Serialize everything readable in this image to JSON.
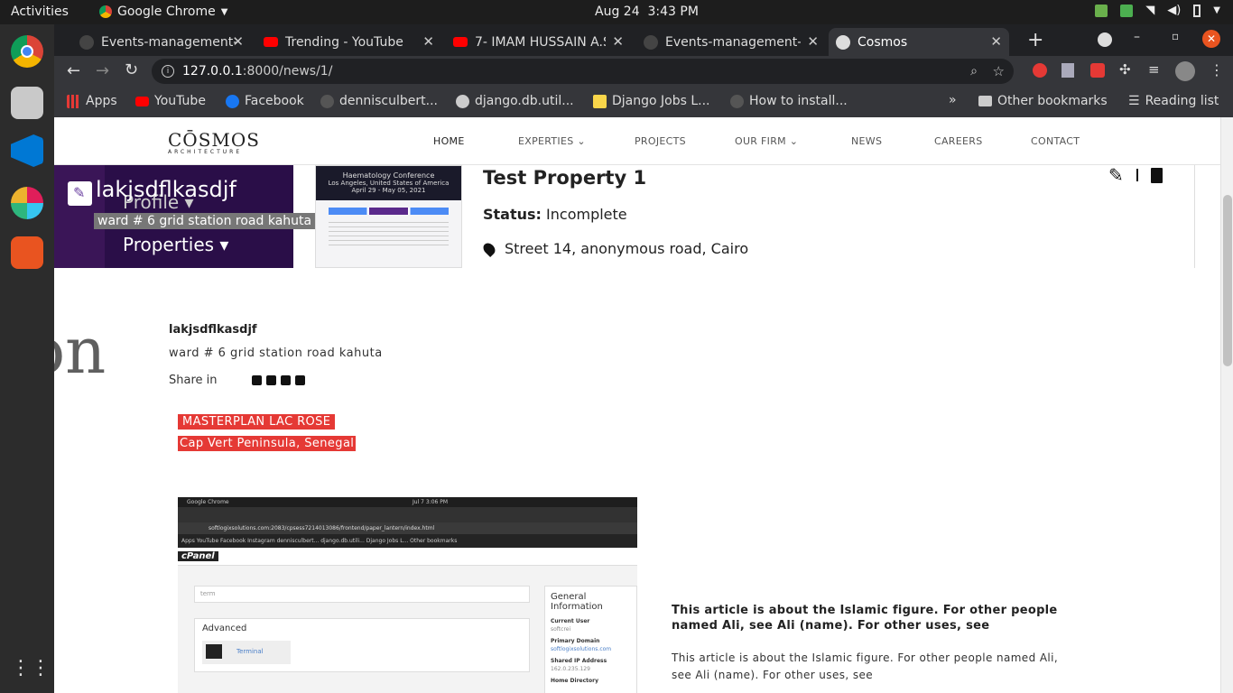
{
  "system": {
    "activities": "Activities",
    "app_name": "Google Chrome",
    "date": "Aug 24",
    "time": "3:43 PM"
  },
  "tabs": [
    {
      "title": "Events-management-",
      "favicon": "github-icon"
    },
    {
      "title": "Trending - YouTube",
      "favicon": "youtube-icon"
    },
    {
      "title": "7- IMAM HUSSAIN A.S",
      "favicon": "youtube-icon"
    },
    {
      "title": "Events-management-",
      "favicon": "github-icon"
    },
    {
      "title": "Cosmos",
      "favicon": "globe-icon"
    }
  ],
  "omnibox": {
    "host": "127.0.0.1",
    "path": ":8000/news/1/"
  },
  "bookmarks": [
    {
      "label": "Apps",
      "icon": "apps-grid-icon"
    },
    {
      "label": "YouTube",
      "icon": "youtube-icon"
    },
    {
      "label": "Facebook",
      "icon": "facebook-icon"
    },
    {
      "label": "dennisculbert...",
      "icon": "github-icon"
    },
    {
      "label": "django.db.util...",
      "icon": "globe-icon"
    },
    {
      "label": "Django Jobs L...",
      "icon": "document-icon"
    },
    {
      "label": "How to install...",
      "icon": "github-icon"
    }
  ],
  "bookmarks_right": {
    "more": "»",
    "other": "Other bookmarks",
    "reading": "Reading list"
  },
  "site": {
    "logo": "CŌSMOS",
    "logo_sub": "ARCHITECTURE",
    "nav": [
      "HOME",
      "EXPERTIES",
      "PROJECTS",
      "OUR FIRM",
      "NEWS",
      "CAREERS",
      "CONTACT"
    ]
  },
  "overlay": {
    "name": "lakjsdflkasdjf",
    "profile": "Profile",
    "address": "ward # 6 grid station road kahuta",
    "properties": "Properties"
  },
  "property_card": {
    "image_banner": "Haematology Conference",
    "image_sub": "Los Angeles, United States of America",
    "image_date": "April 29 - May 05, 2021",
    "title": "Test Property 1",
    "status_label": "Status:",
    "status_value": "Incomplete",
    "location": "Street 14, anonymous road, Cairo"
  },
  "background_text": "on",
  "detail": {
    "name": "lakjsdflkasdjf",
    "address": "ward # 6 grid station road kahuta",
    "share_label": "Share in"
  },
  "highlight": {
    "title": "MASTERPLAN LAC ROSE",
    "subtitle": "Cap Vert Peninsula, Senegal"
  },
  "screenshot": {
    "top_text": "Google Chrome",
    "top_date": "Jul 7  3:06 PM",
    "url": "softlogixsolutions.com:2083/cpsess7214013086/frontend/paper_lantern/index.html",
    "bookmarks_line": "Apps   YouTube   Facebook   Instagram   dennisculbert...   django.db.utili...   Django Jobs L...        Other bookmarks",
    "brand": "cPanel",
    "search": "term",
    "advanced": "Advanced",
    "terminal": "Terminal",
    "general_info": "General Information",
    "current_user_label": "Current User",
    "current_user": "softcrei",
    "primary_domain_label": "Primary Domain",
    "primary_domain": "softlogixsolutions.com",
    "shared_ip_label": "Shared IP Address",
    "shared_ip": "162.0.235.129",
    "home_dir_label": "Home Directory"
  },
  "article": {
    "bold": "This article is about the Islamic figure. For other people named Ali, see Ali (name). For other uses, see",
    "body": "This article is about the Islamic figure. For other people named Ali, see Ali (name). For other uses, see"
  },
  "colors": {
    "accent": "#e53935",
    "purple": "#3a1557",
    "chrome_dark": "#202124",
    "chrome_toolbar": "#35363a"
  }
}
